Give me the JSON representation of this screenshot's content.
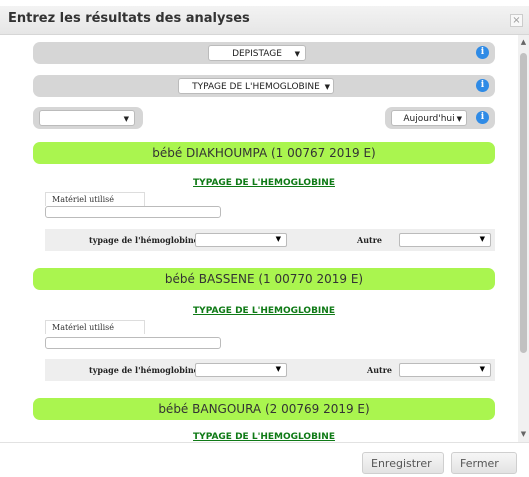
{
  "dialog": {
    "title": "Entrez les résultats des analyses",
    "close_label": "×"
  },
  "filters": {
    "category": "DEPISTAGE",
    "test_type": "TYPAGE DE L'HEMOGLOBINE",
    "left_select": "",
    "date_range": "Aujourd'hui"
  },
  "patients": [
    {
      "name": "bébé DIAKHOUMPA (1 00767 2019 E)"
    },
    {
      "name": "bébé BASSENE (1 00770 2019 E)"
    },
    {
      "name": "bébé BANGOURA (2 00769 2019 E)"
    }
  ],
  "test": {
    "title": "TYPAGE DE L'HEMOGLOBINE",
    "material_label": "Matériel utilisé",
    "hb_label": "typage de l'hémoglobine",
    "other_label": "Autre"
  },
  "footer": {
    "save_label": "Enregistrer",
    "close_label": "Fermer"
  },
  "colors": {
    "patient_bar": "#aaf54f",
    "test_title": "#0f7a16",
    "info": "#2f8be6"
  }
}
